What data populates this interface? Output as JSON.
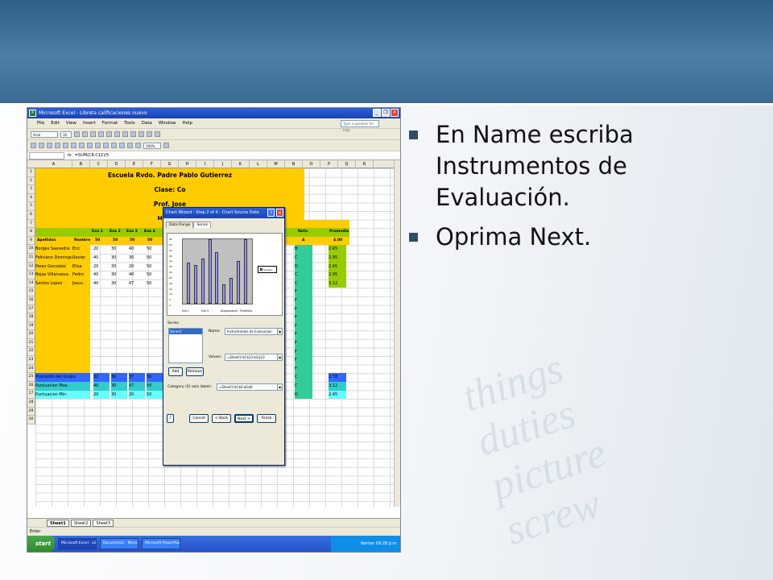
{
  "bullets": [
    "En Name escriba Instrumentos de Evaluación.",
    "Oprima Next."
  ],
  "excel": {
    "window_title": "Microsoft Excel - Libreta calificaciones nuevo",
    "menu": [
      "File",
      "Edit",
      "View",
      "Insert",
      "Format",
      "Tools",
      "Data",
      "Window",
      "Help"
    ],
    "help_placeholder": "Type a question for help",
    "font_name": "Arial",
    "font_size": "10",
    "zoom": "100%",
    "name_box": "",
    "formula": "=SUM(C8:C12)/5",
    "columns": [
      "A",
      "B",
      "C",
      "D",
      "E",
      "F",
      "G",
      "H",
      "I",
      "J",
      "K",
      "L",
      "M",
      "N",
      "O",
      "P",
      "Q",
      "R"
    ],
    "rows": [
      "1",
      "2",
      "3",
      "4",
      "5",
      "6",
      "7",
      "8",
      "9",
      "10",
      "11",
      "12",
      "13",
      "14",
      "15",
      "16",
      "17",
      "18",
      "19",
      "20",
      "21",
      "22",
      "23",
      "24",
      "25",
      "26",
      "27",
      "28",
      "29",
      "30"
    ],
    "title_lines": [
      "Escuela Rvdo. Padre Pablo Gutierrez",
      "Clase: Co",
      "Prof. Jose",
      "Hora: 8"
    ],
    "header_cols": [
      "Exa 1",
      "Exa 2",
      "Exa 3",
      "Exa 4",
      "Nota",
      "Promedio"
    ],
    "row7": [
      "Apellidos",
      "Nombre",
      "50",
      "50",
      "50",
      "50",
      "A",
      "4.00"
    ],
    "students": [
      {
        "apellidos": "Borges Saavedra",
        "nombre": "Eric",
        "e1": "20",
        "e2": "30",
        "e3": "40",
        "e4": "50",
        "nota": "B",
        "prom": "2.45"
      },
      {
        "apellidos": "Feliciano Dominguez",
        "nombre": "Xavier",
        "e1": "40",
        "e2": "30",
        "e3": "30",
        "e4": "50",
        "nota": "C",
        "prom": "2.95"
      },
      {
        "apellidos": "Perez Gonzalez",
        "nombre": "Elisa",
        "e1": "20",
        "e2": "30",
        "e3": "20",
        "e4": "50",
        "nota": "D",
        "prom": "2.45"
      },
      {
        "apellidos": "Rojas Villanueva",
        "nombre": "Pedro",
        "e1": "40",
        "e2": "30",
        "e3": "40",
        "e4": "50",
        "nota": "C",
        "prom": "2.95"
      },
      {
        "apellidos": "Santos Lopez",
        "nombre": "Jesus",
        "e1": "40",
        "e2": "30",
        "e3": "47",
        "e4": "50",
        "nota": "C",
        "prom": "3.12"
      }
    ],
    "f_rows": [
      "F",
      "F",
      "F",
      "F",
      "F",
      "F",
      "F",
      "F",
      "F",
      "F"
    ],
    "summary": [
      {
        "label": "Promedio del Grupo",
        "vals": [
          "32",
          "30",
          "37",
          "50"
        ],
        "nota": "C",
        "prom": "2.78"
      },
      {
        "label": "Puntuacion Max.",
        "vals": [
          "40",
          "30",
          "47",
          "50"
        ],
        "nota": "C",
        "prom": "3.12"
      },
      {
        "label": "Puntuacion Min.",
        "vals": [
          "20",
          "30",
          "20",
          "50"
        ],
        "extra": [
          "70",
          "25",
          "20",
          "50",
          "245",
          "61"
        ],
        "nota": "D",
        "prom": "2.45"
      }
    ],
    "sheets": [
      "Sheet1",
      "Sheet2",
      "Sheet3"
    ],
    "status": "Enter",
    "taskbar": {
      "start": "start",
      "tasks": [
        "Microsoft Excel - Libr...",
        "Document1 - Microsof...",
        "Microsoft PowerPoint ..."
      ],
      "tray": "Norton",
      "clock": "09:28 p.m."
    }
  },
  "dialog": {
    "title": "Chart Wizard - Step 2 of 4 - Chart Source Data",
    "tabs": [
      "Data Range",
      "Series"
    ],
    "series_label": "Series",
    "series_items": [
      "Series1"
    ],
    "name_label": "Name:",
    "name_value": "Instrumentos de Evaluacion",
    "values_label": "Values:",
    "values_value": "=Sheet1!$C$23:$G$23",
    "add_label": "Add",
    "remove_label": "Remove",
    "category_label": "Category (X) axis labels:",
    "category_value": "=Sheet1!$C$6:$G$6",
    "buttons": [
      "Cancel",
      "< Back",
      "Next >",
      "Finish"
    ],
    "legend": "Series1"
  },
  "chart_data": {
    "type": "bar",
    "categories": [
      "Exa 1",
      "Exa 3",
      "Asignaciones",
      "Portafolio"
    ],
    "x_tick_labels": [
      "Exa 1",
      "Exa 3",
      "Asignaciones",
      "Portafolio"
    ],
    "values": [
      38,
      36,
      42,
      60,
      48,
      18,
      24,
      40,
      60
    ],
    "ylim": [
      0,
      60
    ],
    "y_ticks": [
      "60",
      "55",
      "50",
      "45",
      "40",
      "35",
      "30",
      "25",
      "20",
      "15",
      "10",
      "5",
      "0"
    ],
    "legend": [
      "Series1"
    ],
    "legend_position": "right",
    "bar_color": "#9999ff"
  },
  "decor_text": [
    "things",
    "duties",
    "picture",
    "screw"
  ]
}
